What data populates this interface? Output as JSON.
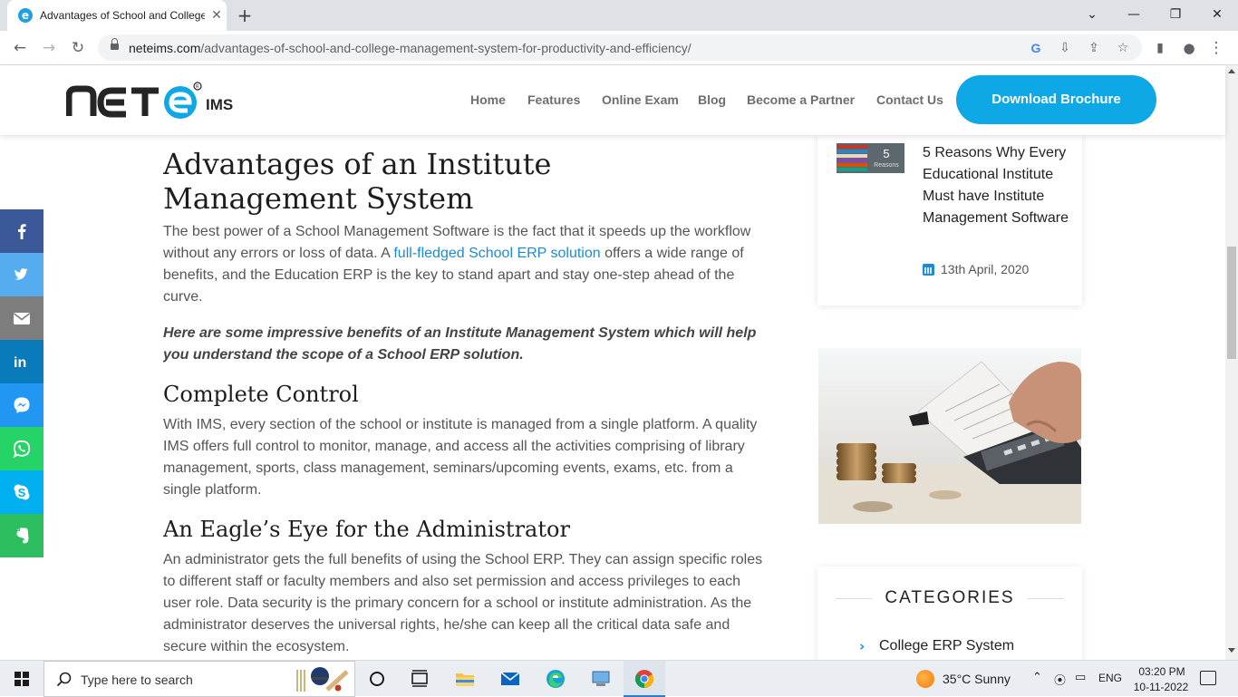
{
  "browser": {
    "tab_title": "Advantages of School and College Management System",
    "tab_favicon": "e",
    "url_host": "neteims.com",
    "url_path": "/advantages-of-school-and-college-management-system-for-productivity-and-efficiency/"
  },
  "site": {
    "brand": "NETE",
    "brand_suffix": "IMS",
    "nav": [
      "Home",
      "Features",
      "Online Exam",
      "Blog",
      "Become a Partner",
      "Contact Us"
    ],
    "cta": "Download Brochure",
    "accent": "#0ea8e6"
  },
  "article": {
    "h1": "Advantages of an Institute Management System",
    "p1_a": "The best power of a School Management Software is the fact that it speeds up the workflow without any errors or loss of data. A ",
    "p1_link": "full-fledged School ERP solution",
    "p1_b": " offers a wide range of benefits, and the Education ERP is the key to stand apart and stay one-step ahead of the curve.",
    "lead": "Here are some impressive benefits of an Institute Management System which will help you understand the scope of a School ERP solution.",
    "h2_control": "Complete Control",
    "p_control": "With IMS, every section of the school or institute is managed from a single platform. A quality IMS offers full control to monitor, manage, and access all the activities comprising of library management, sports, class management, seminars/upcoming events, exams, etc. from a single platform.",
    "h2_eagle": "An Eagle’s Eye for the Administrator",
    "p_eagle": "An administrator gets the full benefits of using the School ERP. They can assign specific roles to different staff or faculty members and also set permission and access privileges to each user role. Data security is the primary concern for a school or institute administration. As the administrator deserves the universal rights, he/she can keep all the critical data safe and secure within the ecosystem."
  },
  "share": [
    {
      "name": "facebook-icon",
      "color": "#3b5998",
      "glyph": "f"
    },
    {
      "name": "twitter-icon",
      "color": "#55acee",
      "glyph": "twitter"
    },
    {
      "name": "email-icon",
      "color": "#7d7d7d",
      "glyph": "email"
    },
    {
      "name": "linkedin-icon",
      "color": "#0a7bba",
      "glyph": "in"
    },
    {
      "name": "messenger-icon",
      "color": "#2196f3",
      "glyph": "messenger"
    },
    {
      "name": "whatsapp-icon",
      "color": "#25d366",
      "glyph": "whatsapp"
    },
    {
      "name": "skype-icon",
      "color": "#00aff0",
      "glyph": "skype"
    },
    {
      "name": "evernote-icon",
      "color": "#2dbe60",
      "glyph": "evernote"
    }
  ],
  "sidebar": {
    "post_thumb_number": "5",
    "post_thumb_label": "Reasons",
    "post_title": "5 Reasons Why Every Educational Institute Must have Institute Management Software",
    "post_date": "13th April, 2020",
    "categories_heading": "CATEGORIES",
    "category_item": "College ERP System"
  },
  "taskbar": {
    "search_placeholder": "Type here to search",
    "weather": "35°C  Sunny",
    "language": "ENG",
    "time": "03:20 PM",
    "date": "10-11-2022"
  }
}
